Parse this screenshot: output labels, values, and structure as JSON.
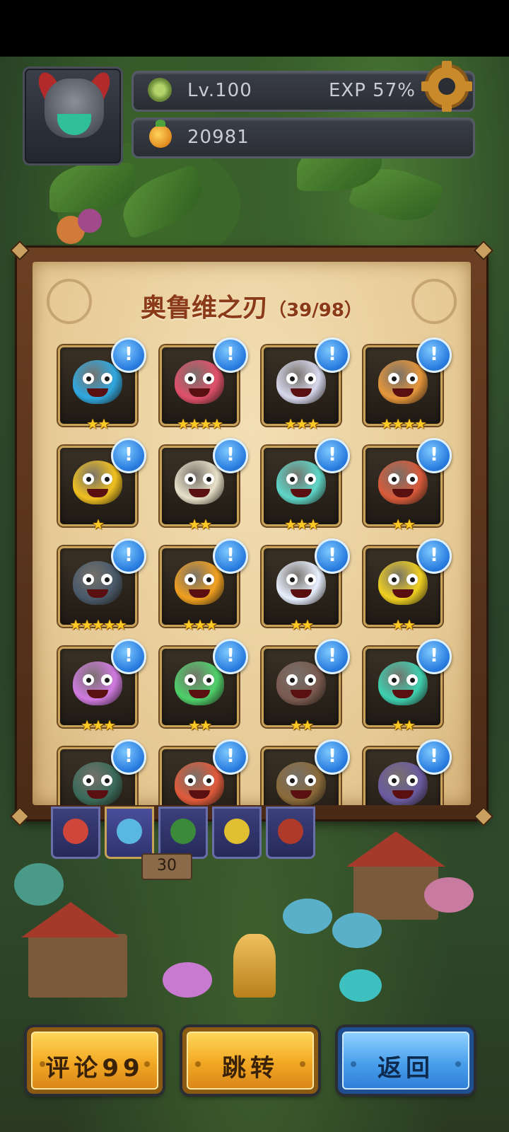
{
  "hud": {
    "level": "Lv.100",
    "exp": "EXP 57%",
    "currency": "20981",
    "settings_icon": "gear-icon",
    "level_icon": "clover-icon",
    "currency_icon": "fruit-icon"
  },
  "panel": {
    "title": "奥鲁维之刃",
    "count": "（39/98）"
  },
  "cards": [
    {
      "stars": "★★",
      "color": "#2fa8e0"
    },
    {
      "stars": "★★★★",
      "color": "#e0506a"
    },
    {
      "stars": "★★★",
      "color": "#d8d8ee"
    },
    {
      "stars": "★★★★",
      "color": "#e6963a"
    },
    {
      "stars": "★",
      "color": "#f0c020"
    },
    {
      "stars": "★★",
      "color": "#e8e0c8"
    },
    {
      "stars": "★★★",
      "color": "#5ed6c8"
    },
    {
      "stars": "★★",
      "color": "#d85a3a"
    },
    {
      "stars": "★★★★★",
      "color": "#4a5a6a"
    },
    {
      "stars": "★★★",
      "color": "#f0a020"
    },
    {
      "stars": "★★",
      "color": "#e8f0ff"
    },
    {
      "stars": "★★",
      "color": "#f0d020"
    },
    {
      "stars": "★★★",
      "color": "#d07ae0"
    },
    {
      "stars": "★★",
      "color": "#4ed06a"
    },
    {
      "stars": "★★",
      "color": "#7a5a50"
    },
    {
      "stars": "★★",
      "color": "#3ed0b0"
    },
    {
      "stars": "",
      "color": "#3a6a5a"
    },
    {
      "stars": "",
      "color": "#e05a3a"
    },
    {
      "stars": "",
      "color": "#8a6a3a"
    },
    {
      "stars": "",
      "color": "#6a5aa0"
    }
  ],
  "badge_label": "!",
  "sign": "30",
  "buttons": {
    "comment": "评论99",
    "jump": "跳转",
    "back": "返回"
  }
}
